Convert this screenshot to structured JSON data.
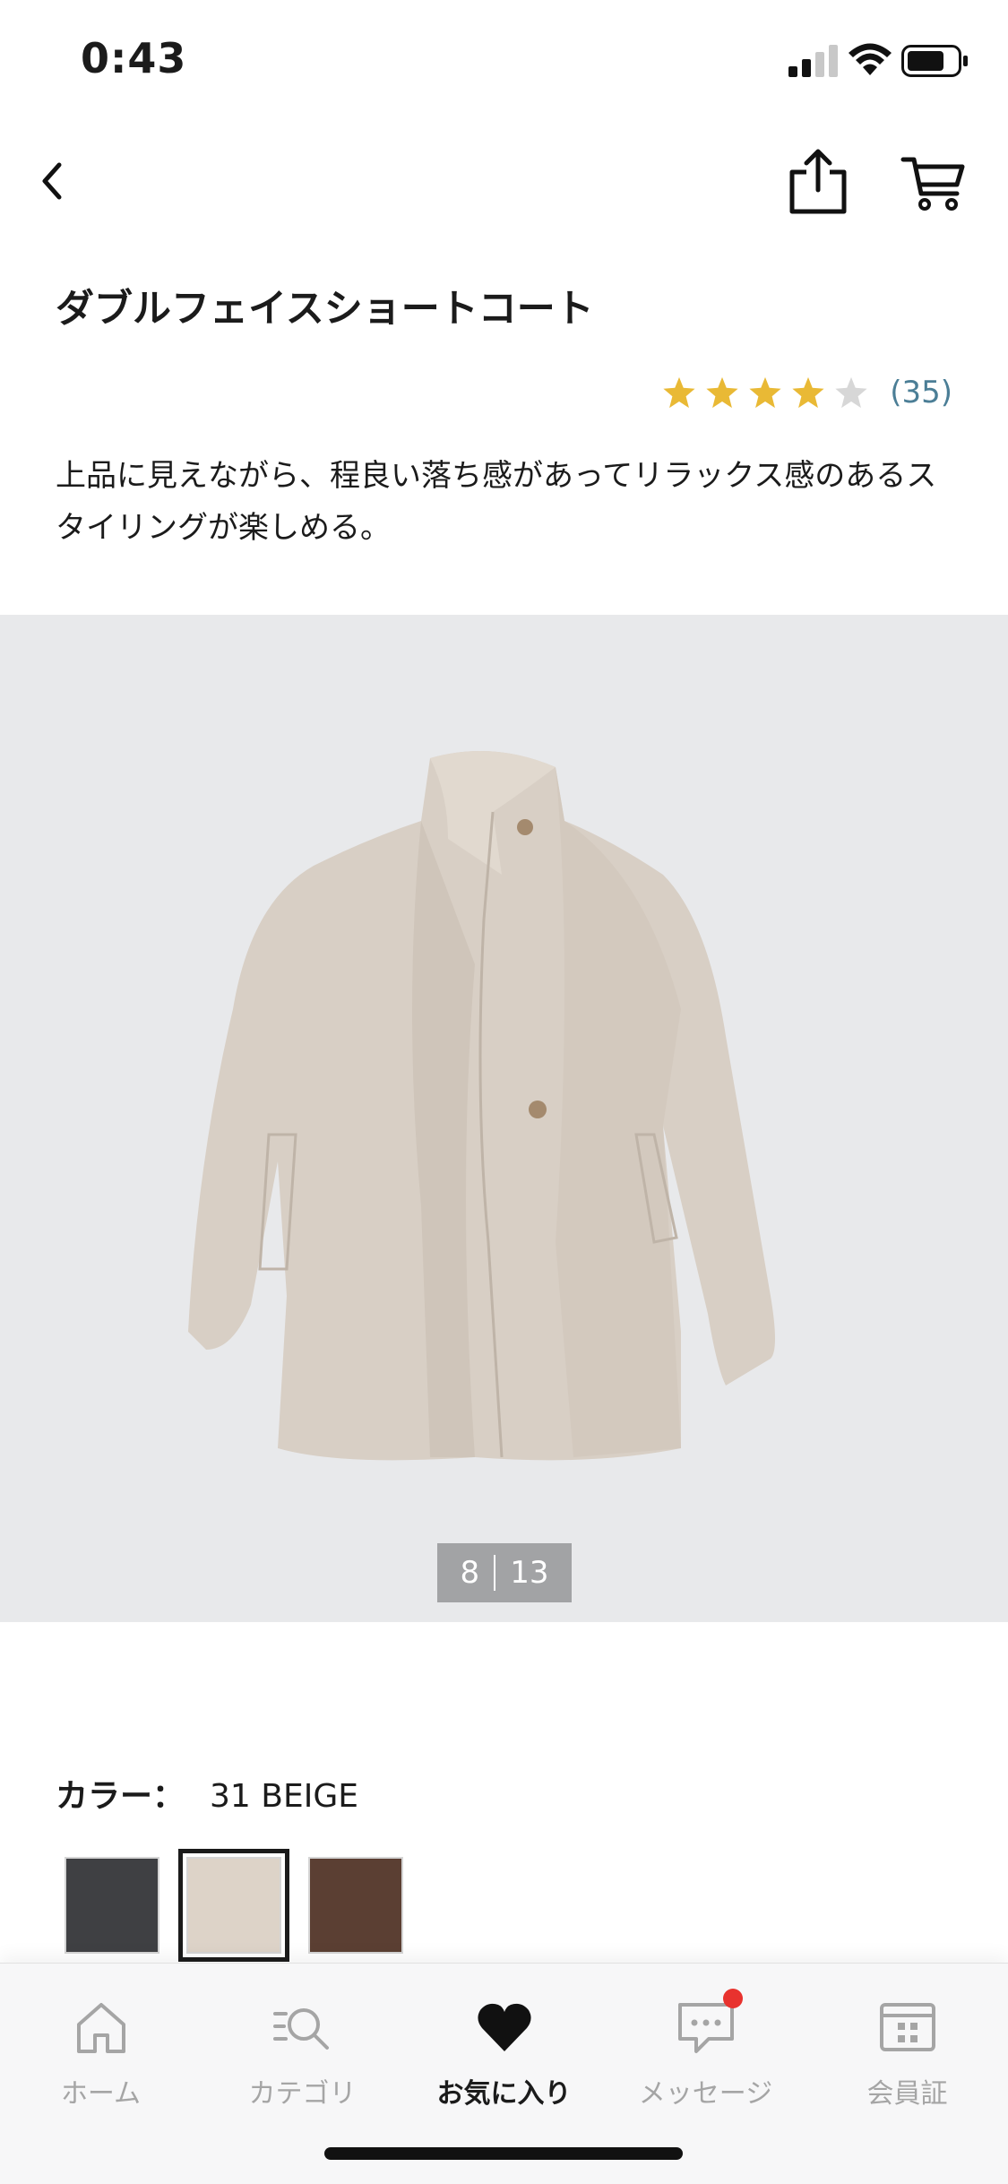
{
  "status_bar": {
    "time": "0:43"
  },
  "product": {
    "title": "ダブルフェイスショートコート",
    "rating": 4,
    "rating_max": 5,
    "review_count": "(35)",
    "description": "上品に見えながら、程良い落ち感があってリラックス感のあるスタイリングが楽しめる。",
    "star_color": "#e9b935",
    "star_empty_color": "#d7d7d7"
  },
  "gallery": {
    "current": "8",
    "total": "13",
    "background": "#e8e9eb"
  },
  "color": {
    "label": "カラー：",
    "value": "31 BEIGE",
    "swatches": [
      {
        "name": "dark-gray",
        "color": "#3f4043",
        "selected": false
      },
      {
        "name": "beige",
        "color": "#ddd3c8",
        "selected": true
      },
      {
        "name": "brown",
        "color": "#5b3f33",
        "selected": false
      }
    ]
  },
  "tabs": [
    {
      "label": "ホーム",
      "icon": "home-icon",
      "active": false
    },
    {
      "label": "カテゴリ",
      "icon": "category-search-icon",
      "active": false
    },
    {
      "label": "お気に入り",
      "icon": "heart-icon",
      "active": true
    },
    {
      "label": "メッセージ",
      "icon": "message-icon",
      "active": false,
      "badge": true
    },
    {
      "label": "会員証",
      "icon": "membership-card-icon",
      "active": false
    }
  ]
}
